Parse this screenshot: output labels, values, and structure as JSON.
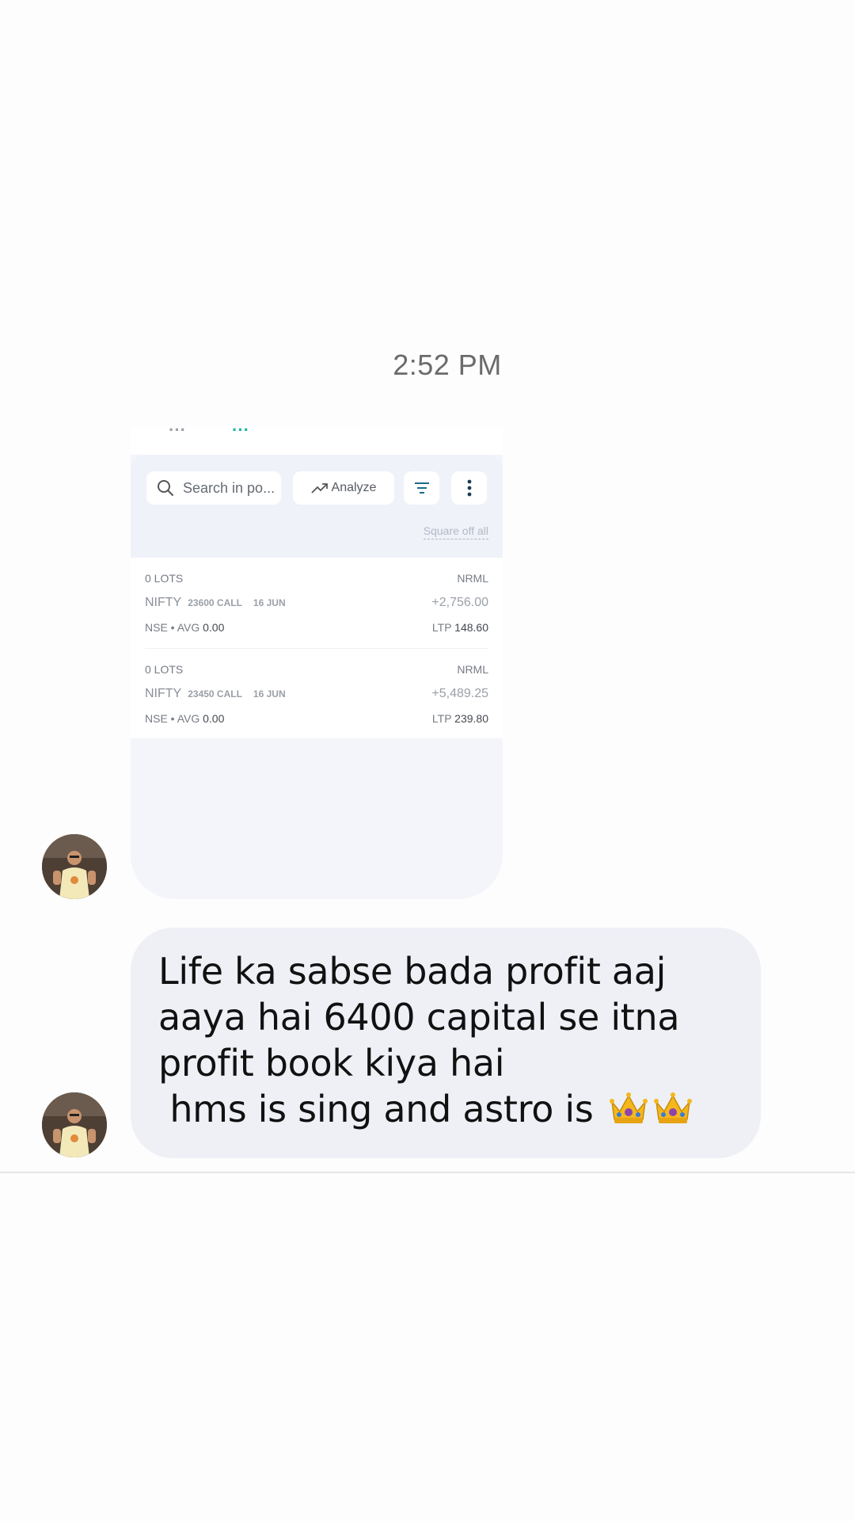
{
  "timestamp": "2:52 PM",
  "attachment": {
    "search_placeholder": "Search in po...",
    "analyze_label": "Analyze",
    "square_off_label": "Square off all",
    "positions": [
      {
        "lots": "0 LOTS",
        "product": "NRML",
        "symbol": "NIFTY",
        "strike": "23600 CALL",
        "expiry": "16 JUN",
        "pnl": "+2,756.00",
        "exchange": "NSE • AVG",
        "avg": "0.00",
        "ltp_label": "LTP",
        "ltp": "148.60"
      },
      {
        "lots": "0 LOTS",
        "product": "NRML",
        "symbol": "NIFTY",
        "strike": "23450 CALL",
        "expiry": "16 JUN",
        "pnl": "+5,489.25",
        "exchange": "NSE • AVG",
        "avg": "0.00",
        "ltp_label": "LTP",
        "ltp": "239.80"
      }
    ]
  },
  "message": {
    "text": "Life ka sabse bada profit aaj aaya hai 6400 capital se itna profit book kiya hai\n hms is sing and astro is ",
    "emoji_icons": [
      "crown-icon",
      "crown-icon"
    ]
  },
  "icons": {
    "search": "search-icon",
    "analyze": "trending-up-icon",
    "filter": "filter-icon",
    "more": "more-vertical-icon"
  },
  "colors": {
    "bubble": "#eef0f6",
    "accent": "#1b6b8a",
    "profit_teal": "#1fb5a7"
  }
}
